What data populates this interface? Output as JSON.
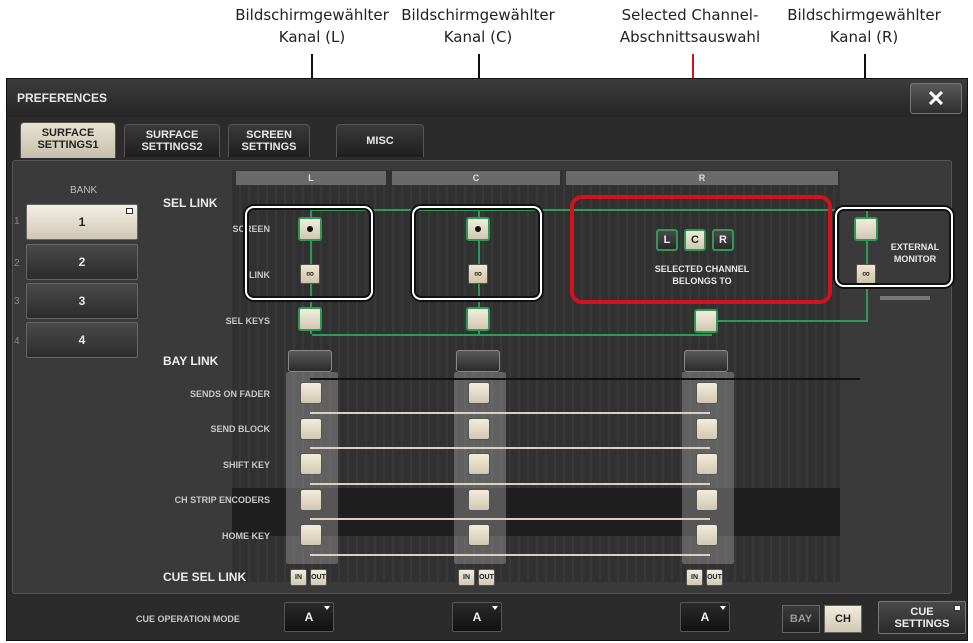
{
  "callouts": [
    {
      "line1": "Bildschirmgewählter",
      "line2": "Kanal (L)"
    },
    {
      "line1": "Bildschirmgewählter",
      "line2": "Kanal (C)"
    },
    {
      "line1": "Selected Channel-",
      "line2": "Abschnittsauswahl"
    },
    {
      "line1": "Bildschirmgewählter",
      "line2": "Kanal (R)"
    }
  ],
  "window": {
    "title": "PREFERENCES",
    "close_icon": "close-icon"
  },
  "tabs": [
    {
      "label": "SURFACE\nSETTINGS1",
      "active": true
    },
    {
      "label": "SURFACE\nSETTINGS2",
      "active": false
    },
    {
      "label": "SCREEN\nSETTINGS",
      "active": false
    },
    {
      "label": "MISC",
      "active": false
    }
  ],
  "bank": {
    "label": "BANK",
    "items": [
      {
        "num": "1",
        "label": "1",
        "active": true
      },
      {
        "num": "2",
        "label": "2",
        "active": false
      },
      {
        "num": "3",
        "label": "3",
        "active": false
      },
      {
        "num": "4",
        "label": "4",
        "active": false
      }
    ]
  },
  "columns": {
    "l": "L",
    "c": "C",
    "r": "R"
  },
  "labels": {
    "sel_link": "SEL LINK",
    "screen": "SCREEN",
    "link": "LINK",
    "sel_keys": "SEL KEYS",
    "bay_link": "BAY LINK",
    "sends_on_fader": "SENDS ON FADER",
    "send_block": "SEND BLOCK",
    "shift_key": "SHIFT KEY",
    "ch_strip_encoders": "CH STRIP ENCODERS",
    "home_key": "HOME KEY",
    "cue_sel_link": "CUE SEL LINK",
    "in": "IN",
    "out": "OUT",
    "link_icon": "∞"
  },
  "selected_channel": {
    "l": "L",
    "c": "C",
    "r": "R",
    "text_line1": "SELECTED CHANNEL",
    "text_line2": "BELONGS TO"
  },
  "external_monitor": {
    "line1": "EXTERNAL",
    "line2": "MONITOR"
  },
  "bottom": {
    "cue_operation_mode": "CUE OPERATION MODE",
    "mode_l": "A",
    "mode_c": "A",
    "mode_r": "A",
    "bay": "BAY",
    "ch": "CH",
    "cue_settings": "CUE\nSETTINGS"
  },
  "colors": {
    "accent_green": "#2e9a55",
    "highlight_red": "#d3131b"
  }
}
